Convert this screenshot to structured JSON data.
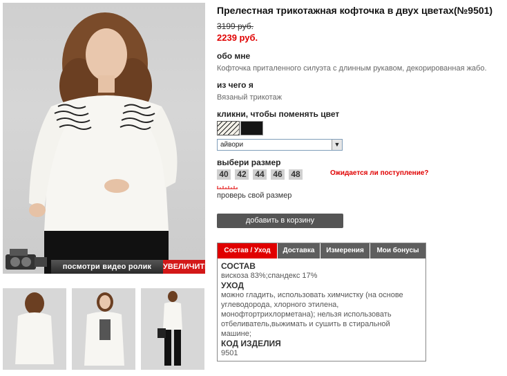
{
  "product": {
    "title": "Прелестная трикотажная кофточка в двух цветах(№9501)",
    "old_price": "3199 руб.",
    "new_price": "2239 руб.",
    "about_heading": "обо мне",
    "about_text": "Кофточка приталенного силуэта с длинным рукавом, декорированная жабо.",
    "material_heading": "из чего я",
    "material_text": "Вязаный трикотаж",
    "color_heading": "кликни, чтобы поменять цвет",
    "selected_color": "айвори",
    "size_heading": "выбери размер",
    "sizes": [
      "40",
      "42",
      "44",
      "46",
      "48"
    ],
    "notify_link": "Ожидается ли поступление?",
    "check_size_link": "проверь свой размер",
    "add_to_cart": "добавить в корзину"
  },
  "media": {
    "video_label": "посмотри видео ролик",
    "zoom_label": "УВЕЛИЧИТЬ"
  },
  "tabs": {
    "items": [
      "Состав / Уход",
      "Доставка",
      "Измерения",
      "Мои бонусы"
    ],
    "active_index": 0,
    "content": {
      "composition_heading": "СОСТАВ",
      "composition_text": "вискоза 83%;спандекс 17%",
      "care_heading": "УХОД",
      "care_text": "можно гладить, использовать химчистку (на основе углеводорода, хлорного этилена, монофтортрихлорметана); нельзя использовать отбеливатель,выжимать и сушить в стиральной машине;",
      "code_heading": "КОД ИЗДЕЛИЯ",
      "code_value": "9501"
    }
  },
  "colors": {
    "accent_red": "#e00000",
    "button_gray": "#555555",
    "tab_gray": "#5e5e5e",
    "swatch_ivory": "#f3f0e8",
    "swatch_black": "#151515"
  }
}
